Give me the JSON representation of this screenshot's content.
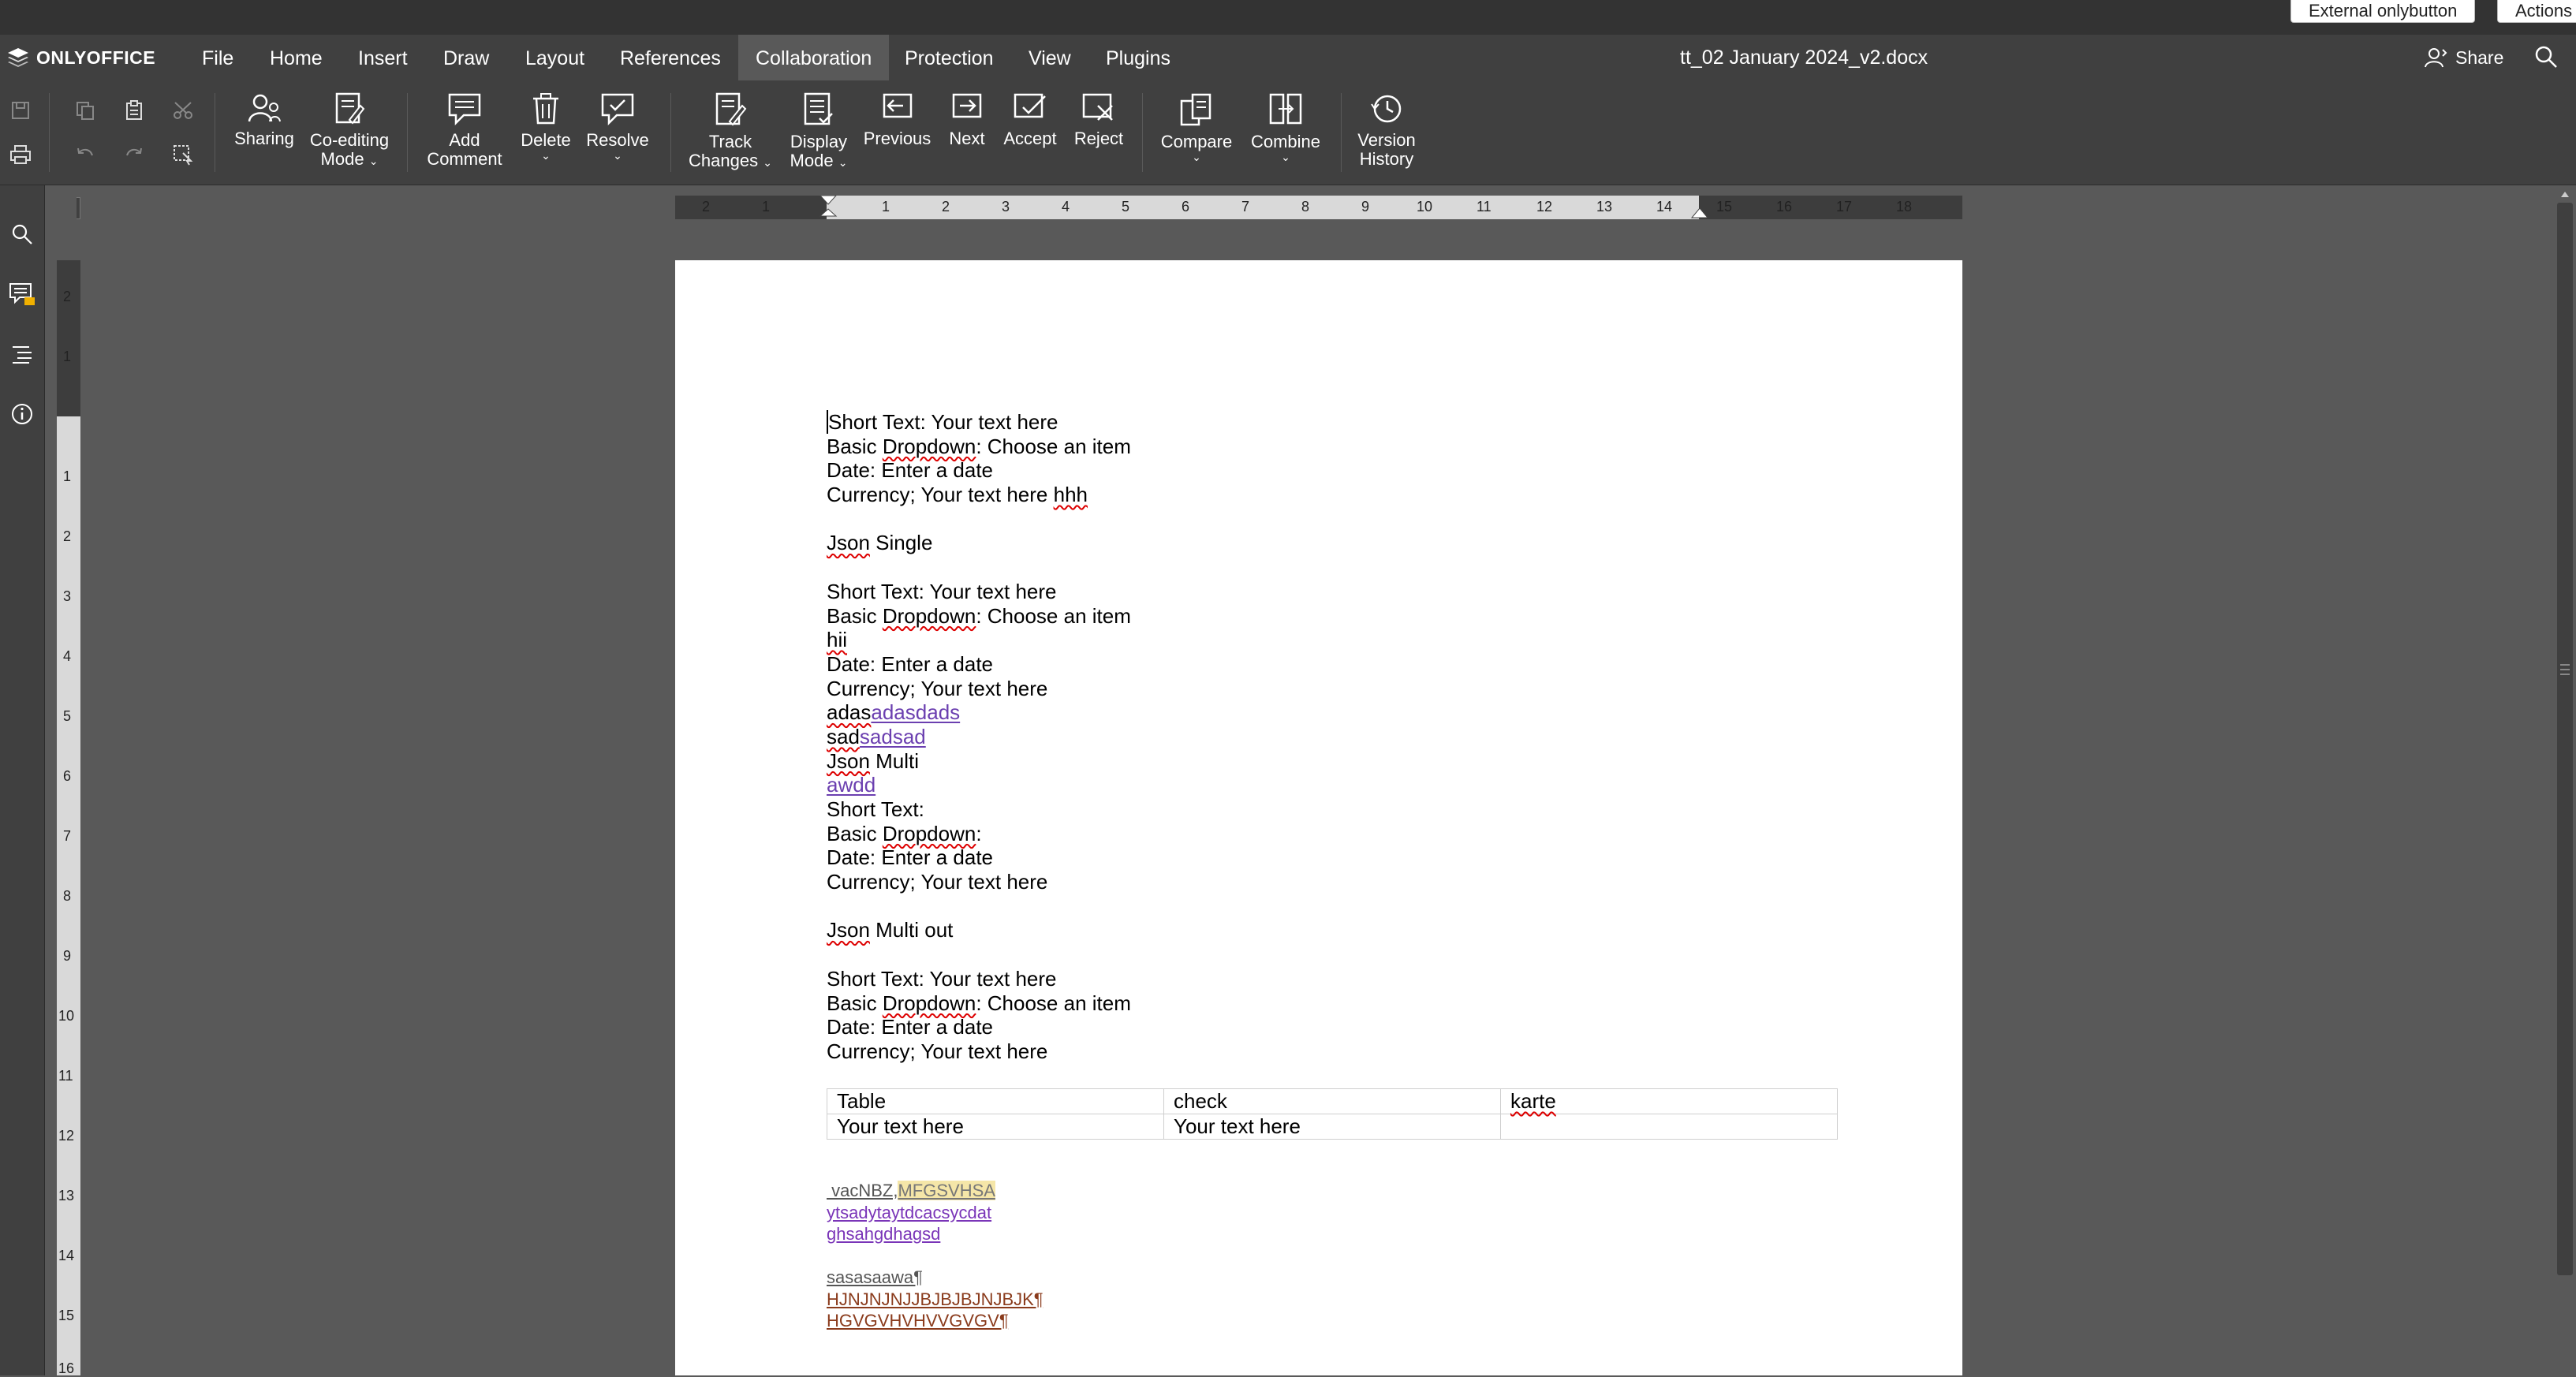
{
  "app": {
    "logo_text": "ONLYOFFICE",
    "external_buttons": [
      "External onlybutton",
      "Actions"
    ],
    "document_title": "tt_02 January 2024_v2.docx",
    "share_label": "Share"
  },
  "menu": [
    "File",
    "Home",
    "Insert",
    "Draw",
    "Layout",
    "References",
    "Collaboration",
    "Protection",
    "View",
    "Plugins"
  ],
  "menu_active": "Collaboration",
  "toolbar": {
    "sharing": "Sharing",
    "coediting": [
      "Co-editing",
      "Mode"
    ],
    "add_comment": [
      "Add",
      "Comment"
    ],
    "delete": "Delete",
    "resolve": "Resolve",
    "track_changes": [
      "Track",
      "Changes"
    ],
    "display_mode": [
      "Display",
      "Mode"
    ],
    "previous": "Previous",
    "next": "Next",
    "accept": "Accept",
    "reject": "Reject",
    "compare": "Compare",
    "combine": "Combine",
    "version_history": [
      "Version",
      "History"
    ]
  },
  "ruler": {
    "h_labels": [
      "2",
      "1",
      "1",
      "2",
      "3",
      "4",
      "5",
      "6",
      "7",
      "8",
      "9",
      "10",
      "11",
      "12",
      "13",
      "14",
      "15",
      "16",
      "17",
      "18"
    ],
    "v_labels": [
      "2",
      "1",
      "1",
      "2",
      "3",
      "4",
      "5",
      "6",
      "7",
      "8",
      "9",
      "10",
      "11",
      "12",
      "13",
      "14",
      "15",
      "16"
    ]
  },
  "document": {
    "l1": "Short Text: Your text here",
    "l2a": "Basic ",
    "l2b": "Dropdown",
    "l2c": ": Choose an item",
    "l3": "Date: Enter a date",
    "l4a": "Currency; Your text here ",
    "l4b": "hhh",
    "l6a": "Json",
    "l6b": " Single",
    "l8": "Short Text: Your text here",
    "l9a": "Basic ",
    "l9b": "Dropdown",
    "l9c": ": Choose an item",
    "l10": "hii",
    "l11": "Date: Enter a date",
    "l12": "Currency; Your text here",
    "l13a": "adas",
    "l13b": "adasdads",
    "l14a": "sad",
    "l14b": "sadsad",
    "l15a": "Json",
    "l15b": " Multi",
    "l16": "awdd",
    "l17": "Short Text:",
    "l18a": "Basic ",
    "l18b": "Dropdown",
    "l18c": ":",
    "l19": "Date: Enter a date",
    "l20": "Currency; Your text here",
    "l22a": "Json",
    "l22b": " Multi out",
    "l24": "Short Text: Your text here",
    "l25a": "Basic ",
    "l25b": "Dropdown",
    "l25c": ": Choose an item",
    "l26": "Date: Enter a date",
    "l27": "Currency; Your text here",
    "table": [
      [
        "Table",
        "check",
        "karte"
      ],
      [
        "Your text here",
        "Your text here",
        ""
      ]
    ],
    "s1a": " vacNBZ,",
    "s1b": "MFGSVHSA",
    "s2": "ytsadytaytdcacsycdat",
    "s3": "ghsahgdhagsd",
    "s5": "sasasaawa¶",
    "s6": "HJNJNJNJJBJBJBJNJBJK¶",
    "s7": "HGVGVHVHVVGVGV¶"
  }
}
